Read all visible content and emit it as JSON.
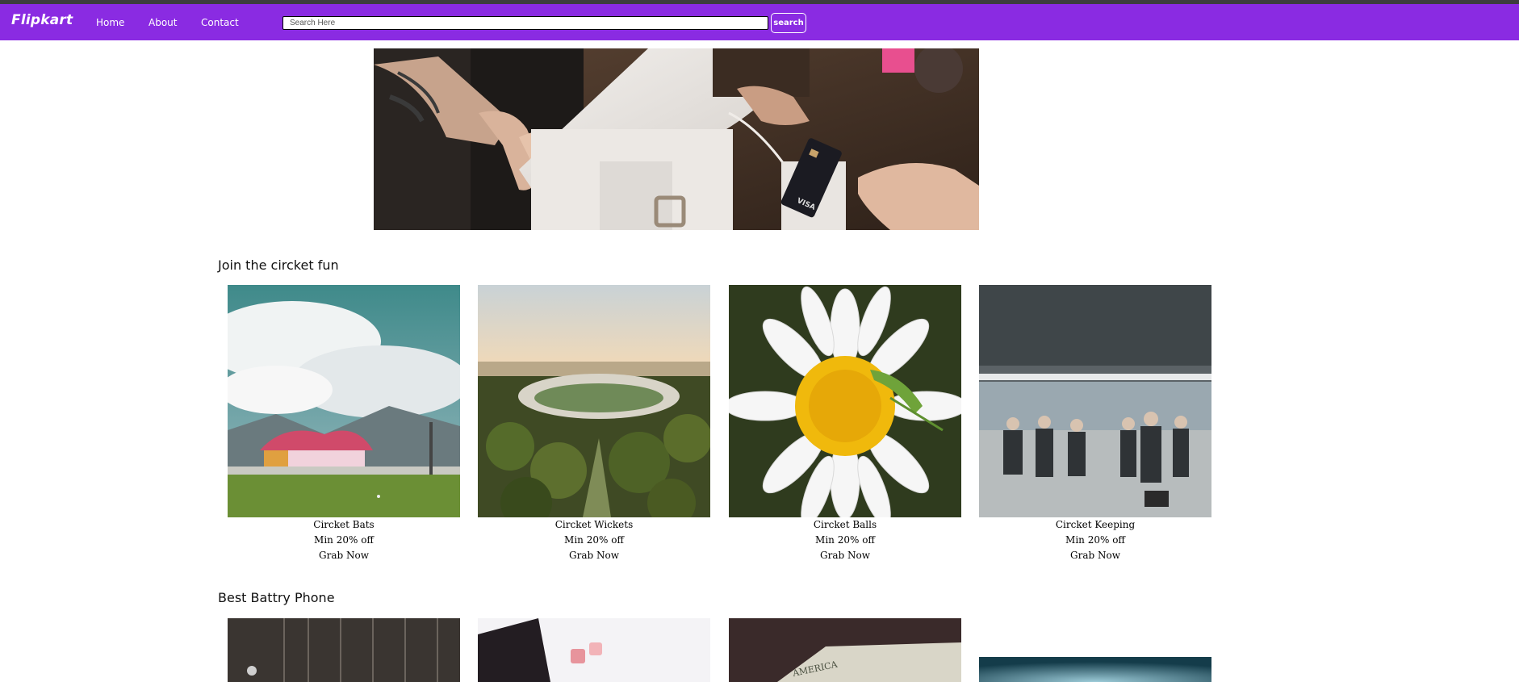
{
  "navbar": {
    "brand": "Flipkart",
    "links": [
      "Home",
      "About",
      "Contact"
    ],
    "search_placeholder": "Search Here",
    "search_button": "search",
    "color": "#8a2be2"
  },
  "sections": [
    {
      "title": "Join the circket fun",
      "cards": [
        {
          "name": "Circket Bats",
          "offer": "Min 20% off",
          "cta": "Grab Now"
        },
        {
          "name": "Circket Wickets",
          "offer": "Min 20% off",
          "cta": "Grab Now"
        },
        {
          "name": "Circket Balls",
          "offer": "Min 20% off",
          "cta": "Grab Now"
        },
        {
          "name": "Circket Keeping",
          "offer": "Min 20% off",
          "cta": "Grab Now"
        }
      ]
    },
    {
      "title": "Best Battry Phone"
    }
  ]
}
